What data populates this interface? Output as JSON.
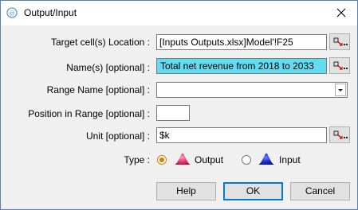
{
  "window": {
    "title": "Output/Input",
    "icons": {
      "app": "app-icon",
      "close": "close-icon"
    }
  },
  "form": {
    "target_label": "Target cell(s) Location :",
    "target_value": "[Inputs Outputs.xlsx]Model'!F25",
    "names_label": "Name(s) [optional] :",
    "names_value": "Total net revenue from 2018 to 2033",
    "range_name_label": "Range Name [optional] :",
    "range_name_value": "",
    "position_label": "Position in Range [optional] :",
    "position_value": "",
    "unit_label": "Unit [optional] :",
    "unit_value": "$k",
    "type_label": "Type :",
    "type_options": [
      {
        "label": "Output",
        "checked": true,
        "color": "#e8336e"
      },
      {
        "label": "Input",
        "checked": false,
        "color": "#1428d8"
      }
    ]
  },
  "buttons": {
    "help": "Help",
    "ok": "OK",
    "cancel": "Cancel"
  },
  "colors": {
    "highlight": "#61dcf0",
    "accent": "#0078d7"
  }
}
